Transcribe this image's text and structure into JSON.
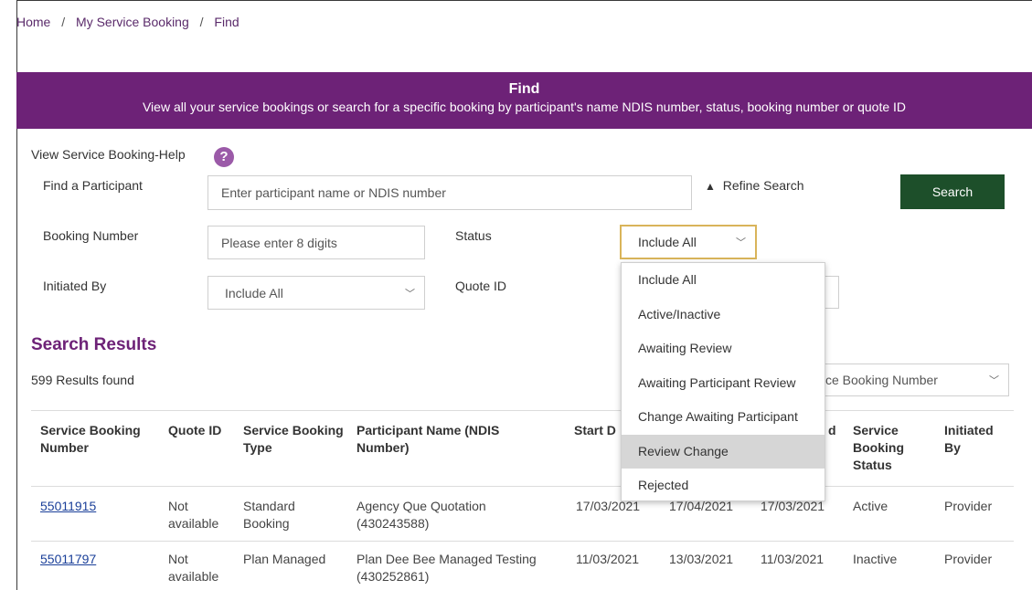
{
  "breadcrumb": {
    "home": "Home",
    "sep": "/",
    "level2": "My Service Booking",
    "current": "Find"
  },
  "banner": {
    "title": "Find",
    "subtitle": "View all your service bookings or search for a specific booking by participant's name NDIS number, status, booking number or quote ID"
  },
  "help": {
    "label": "View Service Booking-Help",
    "icon": "?"
  },
  "form": {
    "find_label": "Find a Participant",
    "find_placeholder": "Enter participant name or NDIS number",
    "refine_label": "Refine Search",
    "search_button": "Search",
    "booking_label": "Booking Number",
    "booking_placeholder": "Please enter 8 digits",
    "status_label": "Status",
    "status_value": "Include All",
    "initiated_label": "Initiated By",
    "initiated_value": "Include All",
    "quote_label": "Quote ID"
  },
  "status_options": [
    "Include All",
    "Active/Inactive",
    "Awaiting Review",
    "Awaiting Participant Review",
    "Change Awaiting Participant",
    "Review Change",
    "Rejected"
  ],
  "status_highlighted": "Review Change",
  "results": {
    "title": "Search Results",
    "count": "599 Results found",
    "sort_value_visible": "ce Booking Number",
    "columns": {
      "number": "Service Booking Number",
      "quote": "Quote ID",
      "type": "Service Booking Type",
      "participant": "Participant Name (NDIS Number)",
      "start": "Start D",
      "end_tail": "d",
      "status": "Service Booking Status",
      "initiated": "Initiated By"
    },
    "rows": [
      {
        "number": "55011915",
        "quote": "Not available",
        "type": "Standard Booking",
        "participant": "Agency Que Quotation (430243588)",
        "start": "17/03/2021",
        "end": "17/04/2021",
        "submitted": "17/03/2021",
        "status": "Active",
        "initiated": "Provider"
      },
      {
        "number": "55011797",
        "quote": "Not available",
        "type": "Plan Managed",
        "participant": "Plan Dee Bee Managed Testing (430252861)",
        "start": "11/03/2021",
        "end": "13/03/2021",
        "submitted": "11/03/2021",
        "status": "Inactive",
        "initiated": "Provider"
      }
    ]
  }
}
